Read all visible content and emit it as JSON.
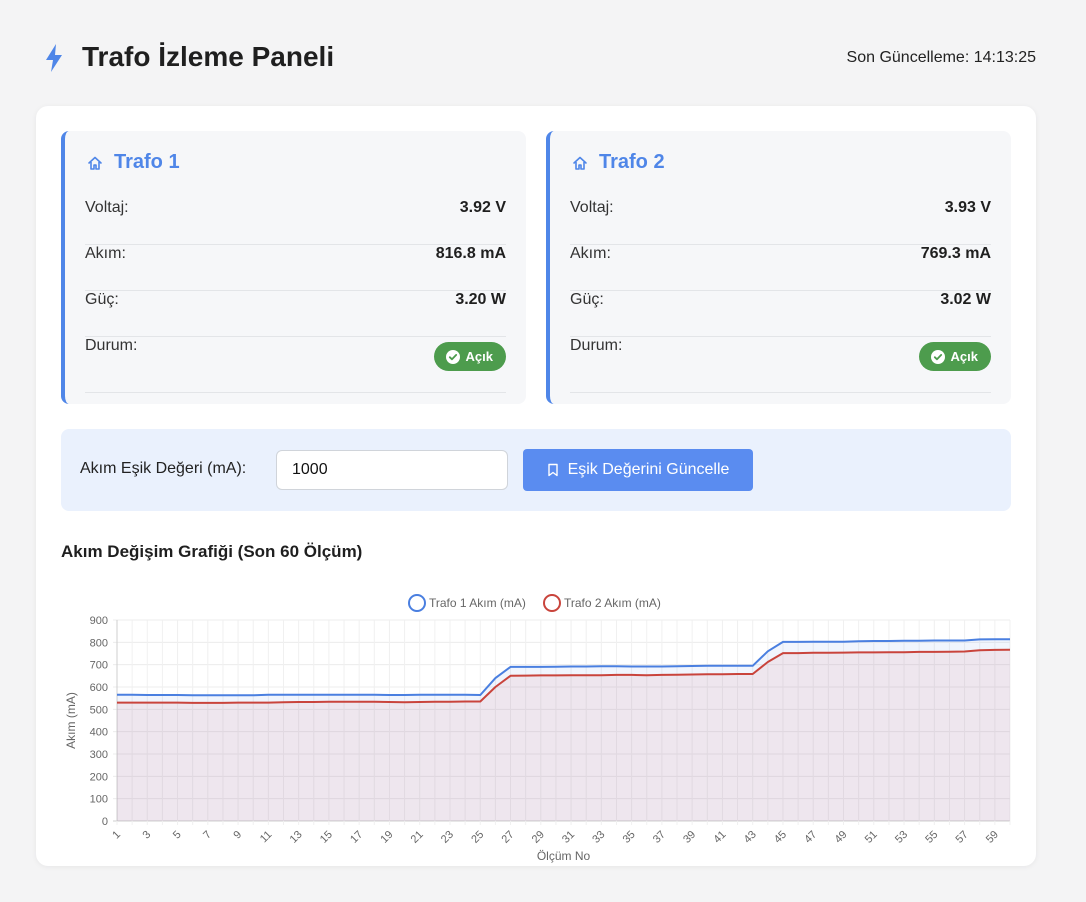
{
  "header": {
    "title": "Trafo İzleme Paneli",
    "last_update": "Son Güncelleme: 14:13:25"
  },
  "trafos": [
    {
      "title": "Trafo 1",
      "voltage_label": "Voltaj:",
      "voltage": "3.92 V",
      "current_label": "Akım:",
      "current": "816.8 mA",
      "power_label": "Güç:",
      "power": "3.20 W",
      "status_label": "Durum:",
      "status": "Açık"
    },
    {
      "title": "Trafo 2",
      "voltage_label": "Voltaj:",
      "voltage": "3.93 V",
      "current_label": "Akım:",
      "current": "769.3 mA",
      "power_label": "Güç:",
      "power": "3.02 W",
      "status_label": "Durum:",
      "status": "Açık"
    }
  ],
  "threshold": {
    "label": "Akım Eşik Değeri (mA):",
    "value": "1000",
    "button_label": "Eşik Değerini Güncelle"
  },
  "chart_title": "Akım Değişim Grafiği (Son 60 Ölçüm)",
  "colors": {
    "accent": "#4f86e8",
    "series1": "#4a7fe0",
    "series2": "#c9443c",
    "status_on": "#4d9c4d"
  },
  "chart_data": {
    "type": "line",
    "xlabel": "Ölçüm No",
    "ylabel": "Akım (mA)",
    "ylim": [
      0,
      900
    ],
    "yticks": [
      0,
      100,
      200,
      300,
      400,
      500,
      600,
      700,
      800,
      900
    ],
    "x": [
      1,
      2,
      3,
      4,
      5,
      6,
      7,
      8,
      9,
      10,
      11,
      12,
      13,
      14,
      15,
      16,
      17,
      18,
      19,
      20,
      21,
      22,
      23,
      24,
      25,
      26,
      27,
      28,
      29,
      30,
      31,
      32,
      33,
      34,
      35,
      36,
      37,
      38,
      39,
      40,
      41,
      42,
      43,
      44,
      45,
      46,
      47,
      48,
      49,
      50,
      51,
      52,
      53,
      54,
      55,
      56,
      57,
      58,
      59,
      60
    ],
    "xticks": [
      1,
      3,
      5,
      7,
      9,
      11,
      13,
      15,
      17,
      19,
      21,
      23,
      25,
      27,
      29,
      31,
      33,
      35,
      37,
      39,
      41,
      43,
      45,
      47,
      49,
      51,
      53,
      55,
      57,
      59
    ],
    "legend": "top-center",
    "grid": true,
    "series": [
      {
        "name": "Trafo 1 Akım (mA)",
        "values": [
          565,
          565,
          564,
          564,
          564,
          563,
          563,
          563,
          563,
          563,
          565,
          565,
          565,
          565,
          565,
          565,
          565,
          565,
          564,
          564,
          565,
          565,
          565,
          565,
          564,
          640,
          690,
          690,
          690,
          691,
          692,
          692,
          693,
          693,
          692,
          692,
          692,
          693,
          694,
          695,
          695,
          695,
          695,
          760,
          802,
          802,
          803,
          803,
          803,
          805,
          806,
          806,
          807,
          807,
          808,
          808,
          808,
          813,
          814,
          814
        ]
      },
      {
        "name": "Trafo 2 Akım (mA)",
        "values": [
          530,
          530,
          530,
          530,
          530,
          529,
          529,
          529,
          530,
          530,
          530,
          532,
          533,
          533,
          534,
          534,
          534,
          534,
          533,
          532,
          533,
          534,
          534,
          535,
          535,
          600,
          650,
          651,
          652,
          652,
          653,
          653,
          653,
          654,
          654,
          653,
          654,
          655,
          656,
          657,
          657,
          658,
          658,
          712,
          752,
          752,
          753,
          753,
          754,
          755,
          755,
          756,
          756,
          757,
          757,
          758,
          759,
          765,
          766,
          767
        ]
      }
    ]
  }
}
